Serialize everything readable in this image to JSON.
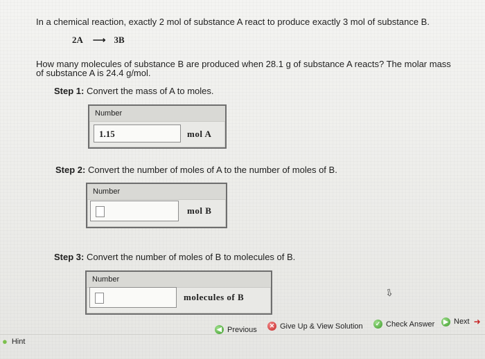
{
  "problem": {
    "intro": "In a chemical reaction, exactly 2 mol of substance A react to produce exactly 3 mol of substance B.",
    "equation_left": "2A",
    "equation_arrow": "⟶",
    "equation_right": "3B",
    "question_line1": "How many molecules of substance B are produced when 28.1 g of substance A reacts? The molar mass",
    "question_line2": "of substance A is 24.4 g/mol."
  },
  "steps": [
    {
      "label": "Step 1:",
      "text": " Convert the mass of A to moles.",
      "field_label": "Number",
      "value": "1.15",
      "unit": "mol  A"
    },
    {
      "label": "Step 2:",
      "text": " Convert the number of moles of A to the number of moles of B.",
      "field_label": "Number",
      "value": "",
      "unit": "mol  B"
    },
    {
      "label": "Step 3:",
      "text": " Convert the number of moles of B to molecules of B.",
      "field_label": "Number",
      "value": "",
      "unit": "molecules  of  B"
    }
  ],
  "nav": {
    "previous": "Previous",
    "give_up": "Give Up & View Solution",
    "check": "Check Answer",
    "next": "Next",
    "hint": "Hint"
  },
  "icons": {
    "previous": "green-circle-arrow-icon",
    "give_up": "red-x-icon",
    "check": "green-check-icon",
    "next": "green-circle-arrow-icon",
    "hint": "lightbulb-icon"
  },
  "colors": {
    "green": "#3d9a2a",
    "red": "#c62323"
  }
}
